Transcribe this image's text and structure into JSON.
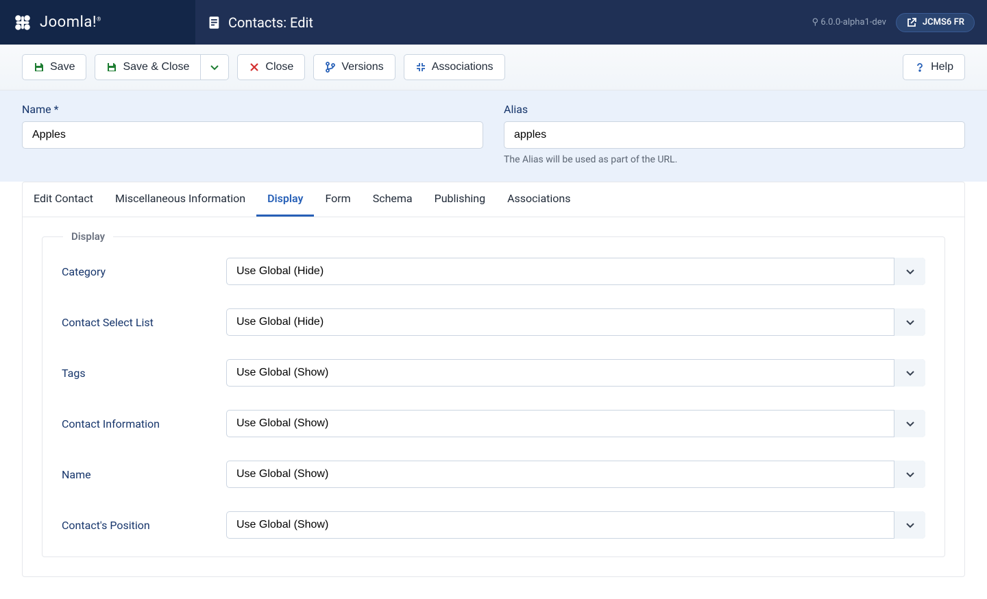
{
  "header": {
    "brand": "Joomla!",
    "title": "Contacts: Edit",
    "version": "6.0.0-alpha1-dev",
    "site_name": "JCMS6 FR"
  },
  "toolbar": {
    "save": "Save",
    "save_close": "Save & Close",
    "close": "Close",
    "versions": "Versions",
    "associations": "Associations",
    "help": "Help"
  },
  "fields": {
    "name_label": "Name *",
    "name_value": "Apples",
    "alias_label": "Alias",
    "alias_value": "apples",
    "alias_help": "The Alias will be used as part of the URL."
  },
  "tabs": [
    {
      "label": "Edit Contact",
      "active": false
    },
    {
      "label": "Miscellaneous Information",
      "active": false
    },
    {
      "label": "Display",
      "active": true
    },
    {
      "label": "Form",
      "active": false
    },
    {
      "label": "Schema",
      "active": false
    },
    {
      "label": "Publishing",
      "active": false
    },
    {
      "label": "Associations",
      "active": false
    }
  ],
  "display_section": {
    "legend": "Display",
    "rows": [
      {
        "label": "Category",
        "value": "Use Global (Hide)"
      },
      {
        "label": "Contact Select List",
        "value": "Use Global (Hide)"
      },
      {
        "label": "Tags",
        "value": "Use Global (Show)"
      },
      {
        "label": "Contact Information",
        "value": "Use Global (Show)"
      },
      {
        "label": "Name",
        "value": "Use Global (Show)"
      },
      {
        "label": "Contact's Position",
        "value": "Use Global (Show)"
      }
    ]
  },
  "icons": {
    "version_prefix": "⚲"
  }
}
